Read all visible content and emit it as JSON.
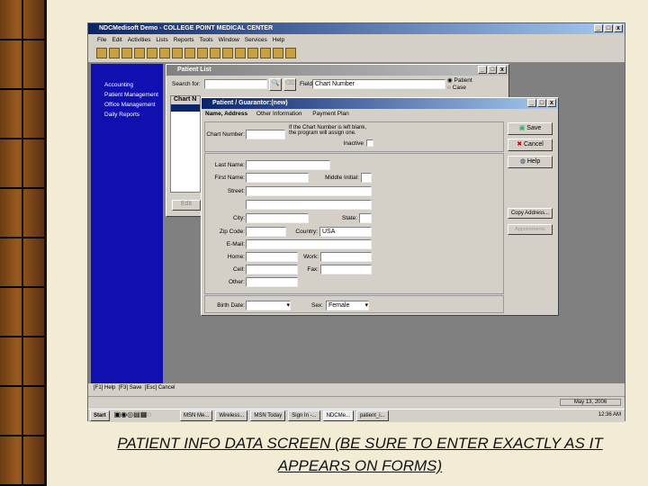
{
  "app": {
    "title": "NDCMedisoft Demo - COLLEGE POINT MEDICAL CENTER",
    "menu": [
      "File",
      "Edit",
      "Activities",
      "Lists",
      "Reports",
      "Tools",
      "Window",
      "Services",
      "Help"
    ],
    "sidebar": [
      "Accounting",
      "Patient Management",
      "Office Management",
      "Daily Reports"
    ]
  },
  "patient_list": {
    "title": "Patient List",
    "search_label": "Search for:",
    "search_value": "",
    "field_label": "Field:",
    "field_value": "Chart Number",
    "radio_patient": "Patient",
    "radio_case": "Case",
    "column": "Chart N",
    "edit_button": "Edit"
  },
  "dialog": {
    "title": "Patient / Guarantor:(new)",
    "tabs": [
      "Name, Address",
      "Other Information",
      "Payment Plan"
    ],
    "chart_number_label": "Chart Number:",
    "chart_note": "If the Chart Number is left blank, the program will assign one.",
    "inactive_label": "Inactive",
    "labels": {
      "last": "Last Name:",
      "first": "First Name:",
      "mi": "Middle Initial:",
      "street": "Street:",
      "city": "City:",
      "state": "State:",
      "zip": "Zip Code:",
      "country": "Country:",
      "email": "E-Mail:",
      "home": "Home:",
      "work": "Work:",
      "cell": "Cell:",
      "fax": "Fax:",
      "other": "Other:",
      "birth": "Birth Date:",
      "sex": "Sex:"
    },
    "values": {
      "country": "USA",
      "sex": "Female"
    },
    "buttons": {
      "save": "Save",
      "cancel": "Cancel",
      "help": "Help",
      "copy": "Copy Address...",
      "appointments": "Appointments"
    }
  },
  "fkeys": [
    {
      "key": "F1",
      "label": "Help"
    },
    {
      "key": "F3",
      "label": "Save"
    },
    {
      "key": "Esc",
      "label": "Cancel"
    }
  ],
  "status_date": "May 13, 2006",
  "taskbar": {
    "start": "Start",
    "items": [
      "MSN Me...",
      "Wireless...",
      "MSN Today",
      "Sign In -...",
      "NDCMe...",
      "patient_i..."
    ],
    "clock": "12:36 AM"
  },
  "caption": "PATIENT INFO DATA SCREEN (BE SURE TO ENTER EXACTLY AS IT APPEARS ON FORMS)"
}
